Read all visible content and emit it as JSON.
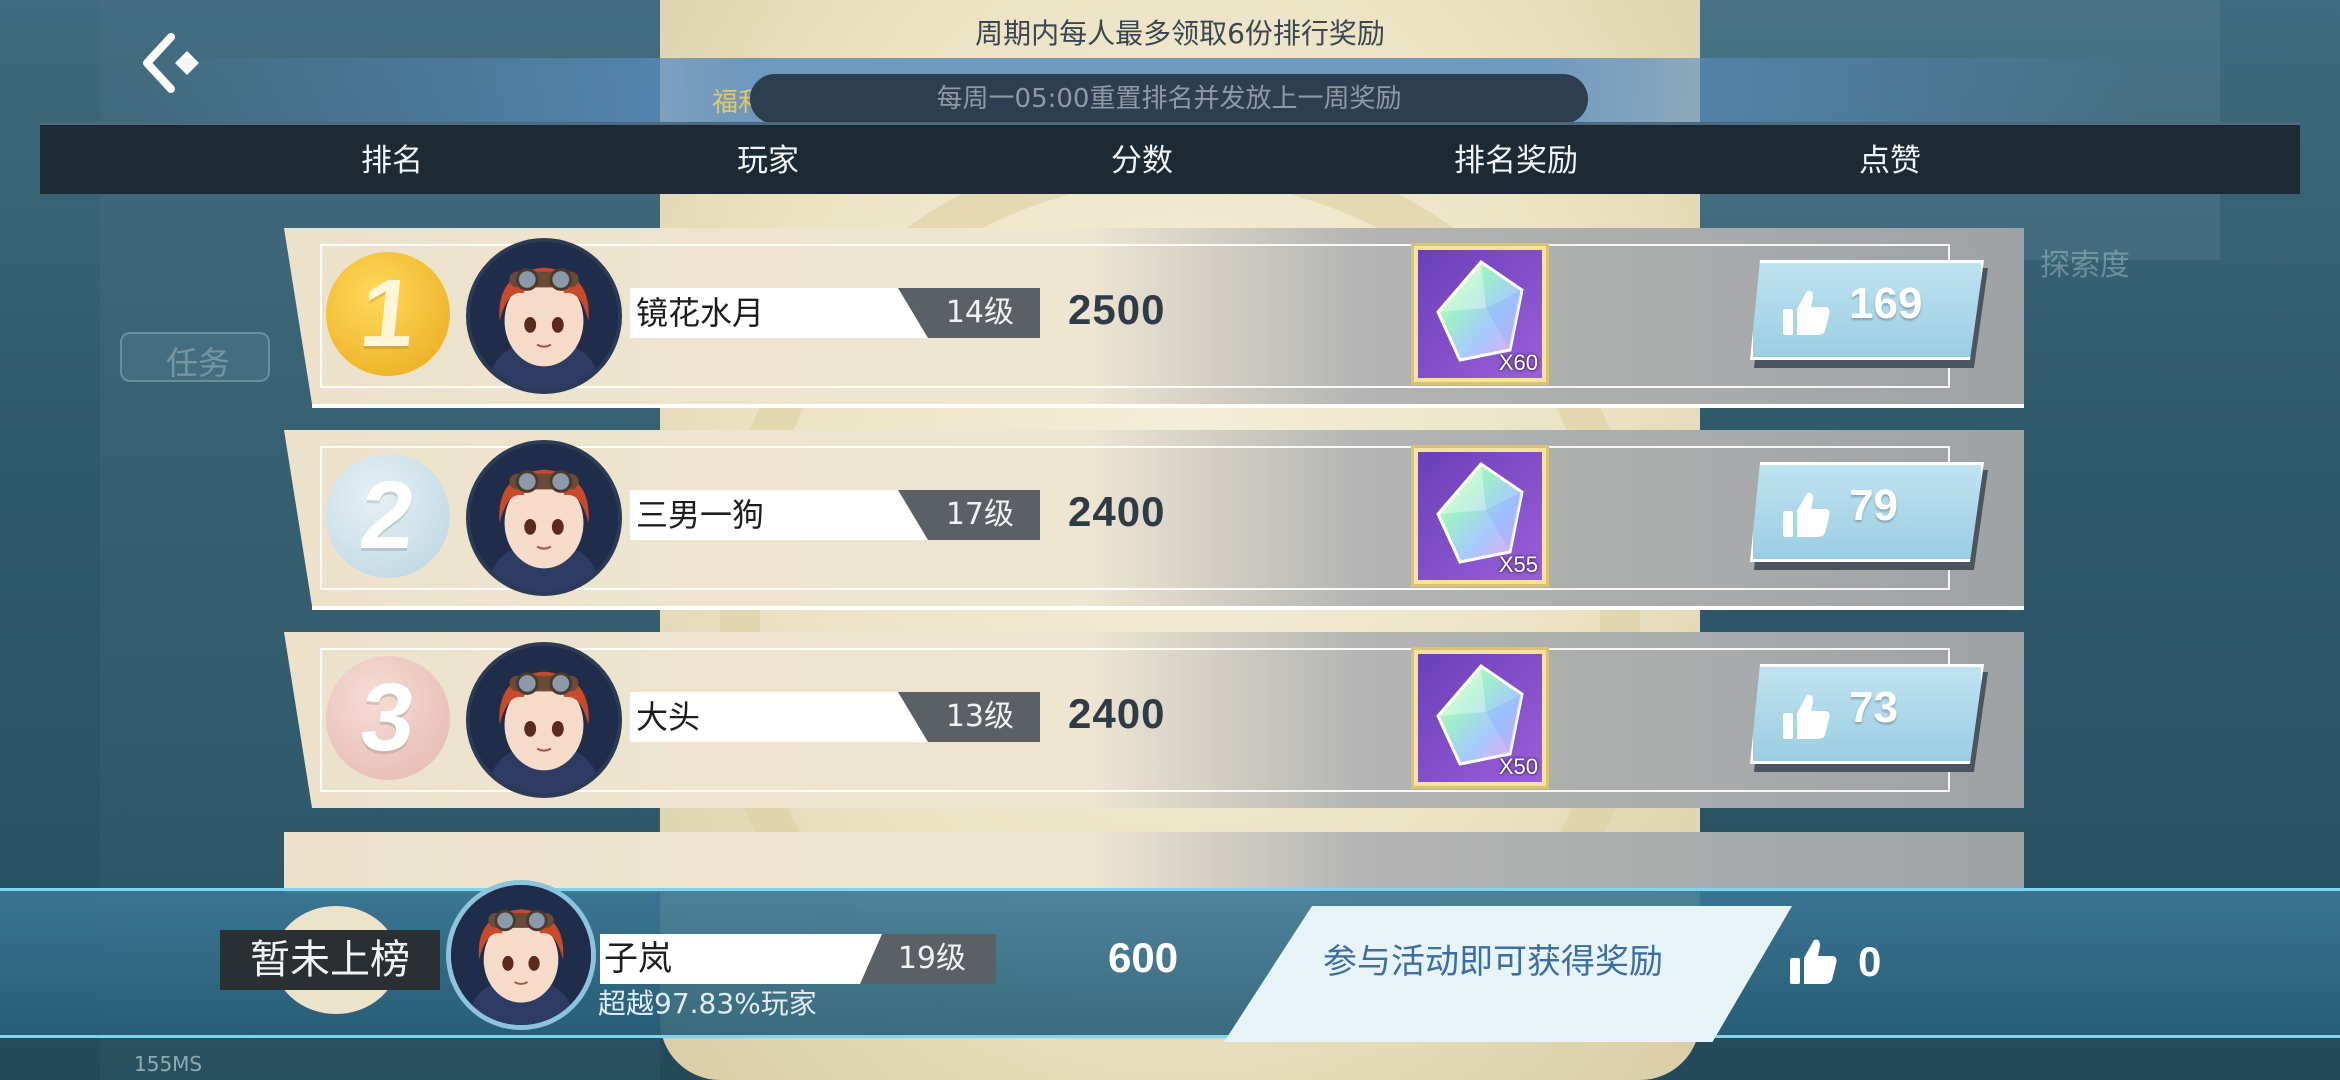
{
  "top_notice": "周期内每人最多领取6份排行奖励",
  "welfare_text": "福利。",
  "reset_notice": "每周一05:00重置排名并发放上一周奖励",
  "headers": {
    "rank": "排名",
    "player": "玩家",
    "score": "分数",
    "reward": "排名奖励",
    "likes": "点赞"
  },
  "rows": [
    {
      "rank": "1",
      "name": "镜花水月",
      "level": "14级",
      "score": "2500",
      "reward_count": "X60",
      "likes": "169"
    },
    {
      "rank": "2",
      "name": "三男一狗",
      "level": "17级",
      "score": "2400",
      "reward_count": "X55",
      "likes": "79"
    },
    {
      "rank": "3",
      "name": "大头",
      "level": "13级",
      "score": "2400",
      "reward_count": "X50",
      "likes": "73"
    }
  ],
  "self": {
    "rank_label": "暂未上榜",
    "name": "子岚",
    "level": "19级",
    "percent": "超越97.83%玩家",
    "score": "600",
    "reward_text": "参与活动即可获得奖励",
    "likes": "0"
  },
  "background": {
    "ping": "155MS",
    "task_label": "任务",
    "exploration_label": "探索度"
  },
  "colors": {
    "medal_gold": "#e9a91c",
    "medal_silver": "#b9d3df",
    "medal_bronze": "#e3b7ad",
    "like_button": "#9bcde2",
    "self_bar_accent": "#7fd4ee",
    "welfare_text": "#e8c75a"
  },
  "icons": {
    "back": "back-chevron-icon",
    "like": "thumbs-up-icon",
    "reward": "rainbow-crystal-icon",
    "avatar": "character-portrait-icon"
  }
}
